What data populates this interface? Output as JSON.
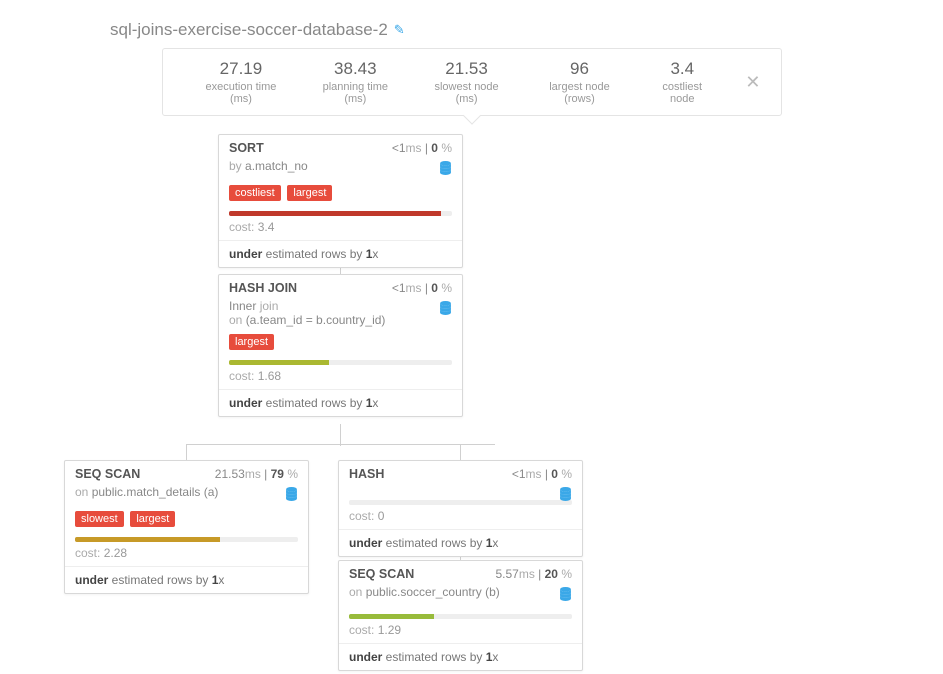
{
  "title": "sql-joins-exercise-soccer-database-2",
  "stats": {
    "execution_time": {
      "value": "27.19",
      "label": "execution time (ms)"
    },
    "planning_time": {
      "value": "38.43",
      "label": "planning time (ms)"
    },
    "slowest_node": {
      "value": "21.53",
      "label": "slowest node (ms)"
    },
    "largest_node": {
      "value": "96",
      "label": "largest node (rows)"
    },
    "costliest_node": {
      "value": "3.4",
      "label": "costliest node"
    }
  },
  "nodes": {
    "sort": {
      "title": "SORT",
      "time": "<1",
      "time_unit": "ms",
      "pct": "0",
      "subtitle_pre": "by ",
      "subtitle": "a.match_no",
      "badges": [
        "costliest",
        "largest"
      ],
      "bar_color": "#c0392b",
      "bar_pct": 95,
      "cost_label": "cost:",
      "cost": "3.4",
      "est_pre": "under",
      "est_mid": " estimated rows by ",
      "est_mult": "1",
      "est_suf": "x"
    },
    "hashjoin": {
      "title": "HASH JOIN",
      "time": "<1",
      "time_unit": "ms",
      "pct": "0",
      "subtitle_l1a": "Inner ",
      "subtitle_l1b": "join",
      "subtitle_l2a": "on ",
      "subtitle_l2b": "(a.team_id = b.country_id)",
      "badges": [
        "largest"
      ],
      "bar_color": "#aab831",
      "bar_pct": 45,
      "cost_label": "cost:",
      "cost": "1.68",
      "est_pre": "under",
      "est_mid": " estimated rows by ",
      "est_mult": "1",
      "est_suf": "x"
    },
    "seqscan1": {
      "title": "SEQ SCAN",
      "time": "21.53",
      "time_unit": "ms",
      "pct": "79",
      "subtitle_pre": "on ",
      "subtitle": "public.match_details (a)",
      "badges": [
        "slowest",
        "largest"
      ],
      "bar_color": "#c79a28",
      "bar_pct": 65,
      "cost_label": "cost:",
      "cost": "2.28",
      "est_pre": "under",
      "est_mid": " estimated rows by ",
      "est_mult": "1",
      "est_suf": "x"
    },
    "hash": {
      "title": "HASH",
      "time": "<1",
      "time_unit": "ms",
      "pct": "0",
      "bar_color": "#c79a28",
      "bar_pct": 0,
      "cost_label": "cost:",
      "cost": "0",
      "est_pre": "under",
      "est_mid": " estimated rows by ",
      "est_mult": "1",
      "est_suf": "x"
    },
    "seqscan2": {
      "title": "SEQ SCAN",
      "time": "5.57",
      "time_unit": "ms",
      "pct": "20",
      "subtitle_pre": "on ",
      "subtitle": "public.soccer_country (b)",
      "bar_color": "#98bb3b",
      "bar_pct": 38,
      "cost_label": "cost:",
      "cost": "1.29",
      "est_pre": "under",
      "est_mid": " estimated rows by ",
      "est_mult": "1",
      "est_suf": "x"
    }
  }
}
